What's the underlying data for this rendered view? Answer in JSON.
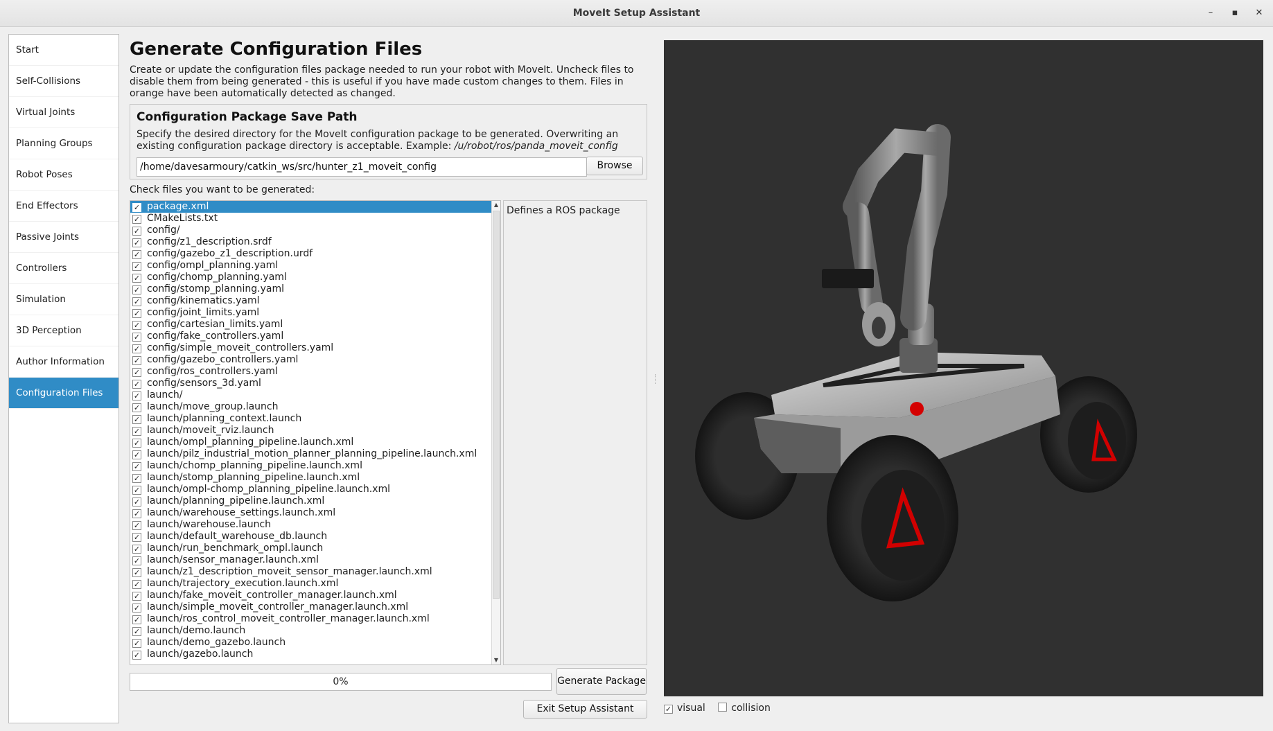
{
  "window": {
    "title": "MoveIt Setup Assistant",
    "controls": [
      "–",
      "▪",
      "✕"
    ]
  },
  "sidebar": {
    "items": [
      {
        "label": "Start",
        "active": false
      },
      {
        "label": "Self-Collisions",
        "active": false
      },
      {
        "label": "Virtual Joints",
        "active": false
      },
      {
        "label": "Planning Groups",
        "active": false
      },
      {
        "label": "Robot Poses",
        "active": false
      },
      {
        "label": "End Effectors",
        "active": false
      },
      {
        "label": "Passive Joints",
        "active": false
      },
      {
        "label": "Controllers",
        "active": false
      },
      {
        "label": "Simulation",
        "active": false
      },
      {
        "label": "3D Perception",
        "active": false
      },
      {
        "label": "Author Information",
        "active": false
      },
      {
        "label": "Configuration Files",
        "active": true
      }
    ]
  },
  "main": {
    "title": "Generate Configuration Files",
    "intro": "Create or update the configuration files package needed to run your robot with MoveIt. Uncheck files to disable them from being generated - this is useful if you have made custom changes to them. Files in orange have been automatically detected as changed.",
    "save_path": {
      "title": "Configuration Package Save Path",
      "description": "Specify the desired directory for the MoveIt configuration package to be generated. Overwriting an existing configuration package directory is acceptable. Example: ",
      "example": "/u/robot/ros/panda_moveit_config",
      "value": "/home/davesarmoury/catkin_ws/src/hunter_z1_moveit_config",
      "browse_label": "Browse"
    },
    "check_files_label": "Check files you want to be generated:",
    "files": [
      {
        "name": "package.xml",
        "checked": true,
        "selected": true
      },
      {
        "name": "CMakeLists.txt",
        "checked": true
      },
      {
        "name": "config/",
        "checked": true
      },
      {
        "name": "config/z1_description.srdf",
        "checked": true
      },
      {
        "name": "config/gazebo_z1_description.urdf",
        "checked": true
      },
      {
        "name": "config/ompl_planning.yaml",
        "checked": true
      },
      {
        "name": "config/chomp_planning.yaml",
        "checked": true
      },
      {
        "name": "config/stomp_planning.yaml",
        "checked": true
      },
      {
        "name": "config/kinematics.yaml",
        "checked": true
      },
      {
        "name": "config/joint_limits.yaml",
        "checked": true
      },
      {
        "name": "config/cartesian_limits.yaml",
        "checked": true
      },
      {
        "name": "config/fake_controllers.yaml",
        "checked": true
      },
      {
        "name": "config/simple_moveit_controllers.yaml",
        "checked": true
      },
      {
        "name": "config/gazebo_controllers.yaml",
        "checked": true
      },
      {
        "name": "config/ros_controllers.yaml",
        "checked": true
      },
      {
        "name": "config/sensors_3d.yaml",
        "checked": true
      },
      {
        "name": "launch/",
        "checked": true
      },
      {
        "name": "launch/move_group.launch",
        "checked": true
      },
      {
        "name": "launch/planning_context.launch",
        "checked": true
      },
      {
        "name": "launch/moveit_rviz.launch",
        "checked": true
      },
      {
        "name": "launch/ompl_planning_pipeline.launch.xml",
        "checked": true
      },
      {
        "name": "launch/pilz_industrial_motion_planner_planning_pipeline.launch.xml",
        "checked": true
      },
      {
        "name": "launch/chomp_planning_pipeline.launch.xml",
        "checked": true
      },
      {
        "name": "launch/stomp_planning_pipeline.launch.xml",
        "checked": true
      },
      {
        "name": "launch/ompl-chomp_planning_pipeline.launch.xml",
        "checked": true
      },
      {
        "name": "launch/planning_pipeline.launch.xml",
        "checked": true
      },
      {
        "name": "launch/warehouse_settings.launch.xml",
        "checked": true
      },
      {
        "name": "launch/warehouse.launch",
        "checked": true
      },
      {
        "name": "launch/default_warehouse_db.launch",
        "checked": true
      },
      {
        "name": "launch/run_benchmark_ompl.launch",
        "checked": true
      },
      {
        "name": "launch/sensor_manager.launch.xml",
        "checked": true
      },
      {
        "name": "launch/z1_description_moveit_sensor_manager.launch.xml",
        "checked": true
      },
      {
        "name": "launch/trajectory_execution.launch.xml",
        "checked": true
      },
      {
        "name": "launch/fake_moveit_controller_manager.launch.xml",
        "checked": true
      },
      {
        "name": "launch/simple_moveit_controller_manager.launch.xml",
        "checked": true
      },
      {
        "name": "launch/ros_control_moveit_controller_manager.launch.xml",
        "checked": true
      },
      {
        "name": "launch/demo.launch",
        "checked": true
      },
      {
        "name": "launch/demo_gazebo.launch",
        "checked": true
      },
      {
        "name": "launch/gazebo.launch",
        "checked": true
      }
    ],
    "file_description": "Defines a ROS package",
    "progress_text": "0%",
    "progress_value": 0,
    "generate_label": "Generate Package",
    "exit_label": "Exit Setup Assistant"
  },
  "viewer": {
    "visual_label": "visual",
    "visual_checked": true,
    "collision_label": "collision",
    "collision_checked": false,
    "background_color": "#303030",
    "accent_color": "#308cc6",
    "highlight_color": "#e01010"
  }
}
